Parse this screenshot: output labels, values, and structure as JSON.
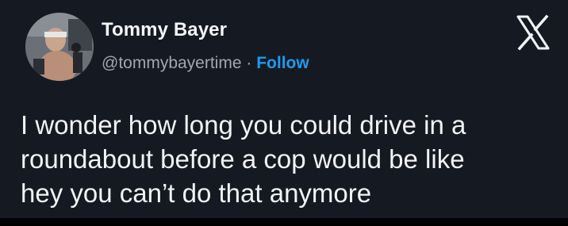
{
  "author": {
    "name": "Tommy Bayer",
    "handle": "@tommybayertime",
    "separator": "·",
    "follow_label": "Follow",
    "avatar_icon": "profile-photo"
  },
  "platform": {
    "logo_icon": "x-logo-icon"
  },
  "tweet": {
    "lines": [
      "I wonder how long you could drive in a",
      "roundabout before a cop would be like",
      "hey you can’t do that anymore"
    ]
  },
  "colors": {
    "background": "#151a22",
    "text": "#f2f3f5",
    "muted": "#a0a7b1",
    "accent": "#1d9bf0"
  }
}
